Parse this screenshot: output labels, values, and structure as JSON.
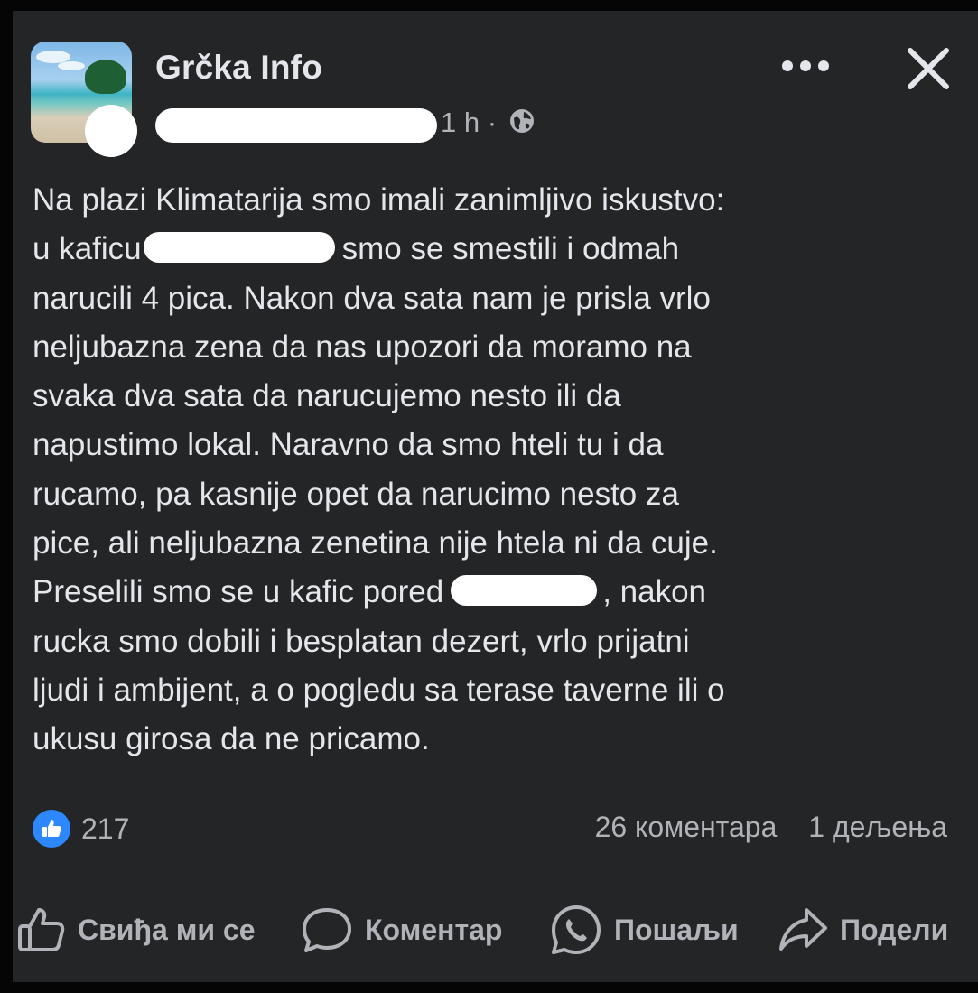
{
  "post": {
    "page_name": "Grčka Info",
    "time": "1 h",
    "separator": "·",
    "visibility_icon": "globe-icon",
    "text_lines": [
      [
        "Na plazi Klimatarija smo imali zanimljivo iskustvo:"
      ],
      [
        "u kaficu",
        "smo se smestili i odmah"
      ],
      [
        "narucili 4 pica. Nakon dva sata nam je prisla vrlo"
      ],
      [
        "neljubazna zena da nas upozori da moramo na"
      ],
      [
        "svaka dva sata da narucujemo nesto ili da"
      ],
      [
        "napustimo lokal. Naravno da smo hteli tu i da"
      ],
      [
        "rucamo, pa kasnije opet da narucimo nesto za"
      ],
      [
        "pice, ali neljubazna zenetina nije htela ni da cuje."
      ],
      [
        "Preselili smo se u kafic pored",
        ", nakon"
      ],
      [
        "rucka smo dobili i besplatan dezert, vrlo prijatni"
      ],
      [
        "ljudi i ambijent, a o pogledu sa terase taverne ili o"
      ],
      [
        "ukusu girosa da ne pricamo."
      ]
    ]
  },
  "engagement": {
    "reaction_icon": "thumbs-up-icon",
    "reactions_count": "217",
    "comments": "26 коментара",
    "shares": "1 дељења"
  },
  "actions": {
    "like": "Свиђа ми се",
    "comment": "Коментар",
    "send": "Пошаљи",
    "share": "Подели"
  },
  "colors": {
    "background": "#242526",
    "text_primary": "#e4e6eb",
    "text_secondary": "#b0b3b8",
    "like_blue": "#2d88ff"
  }
}
